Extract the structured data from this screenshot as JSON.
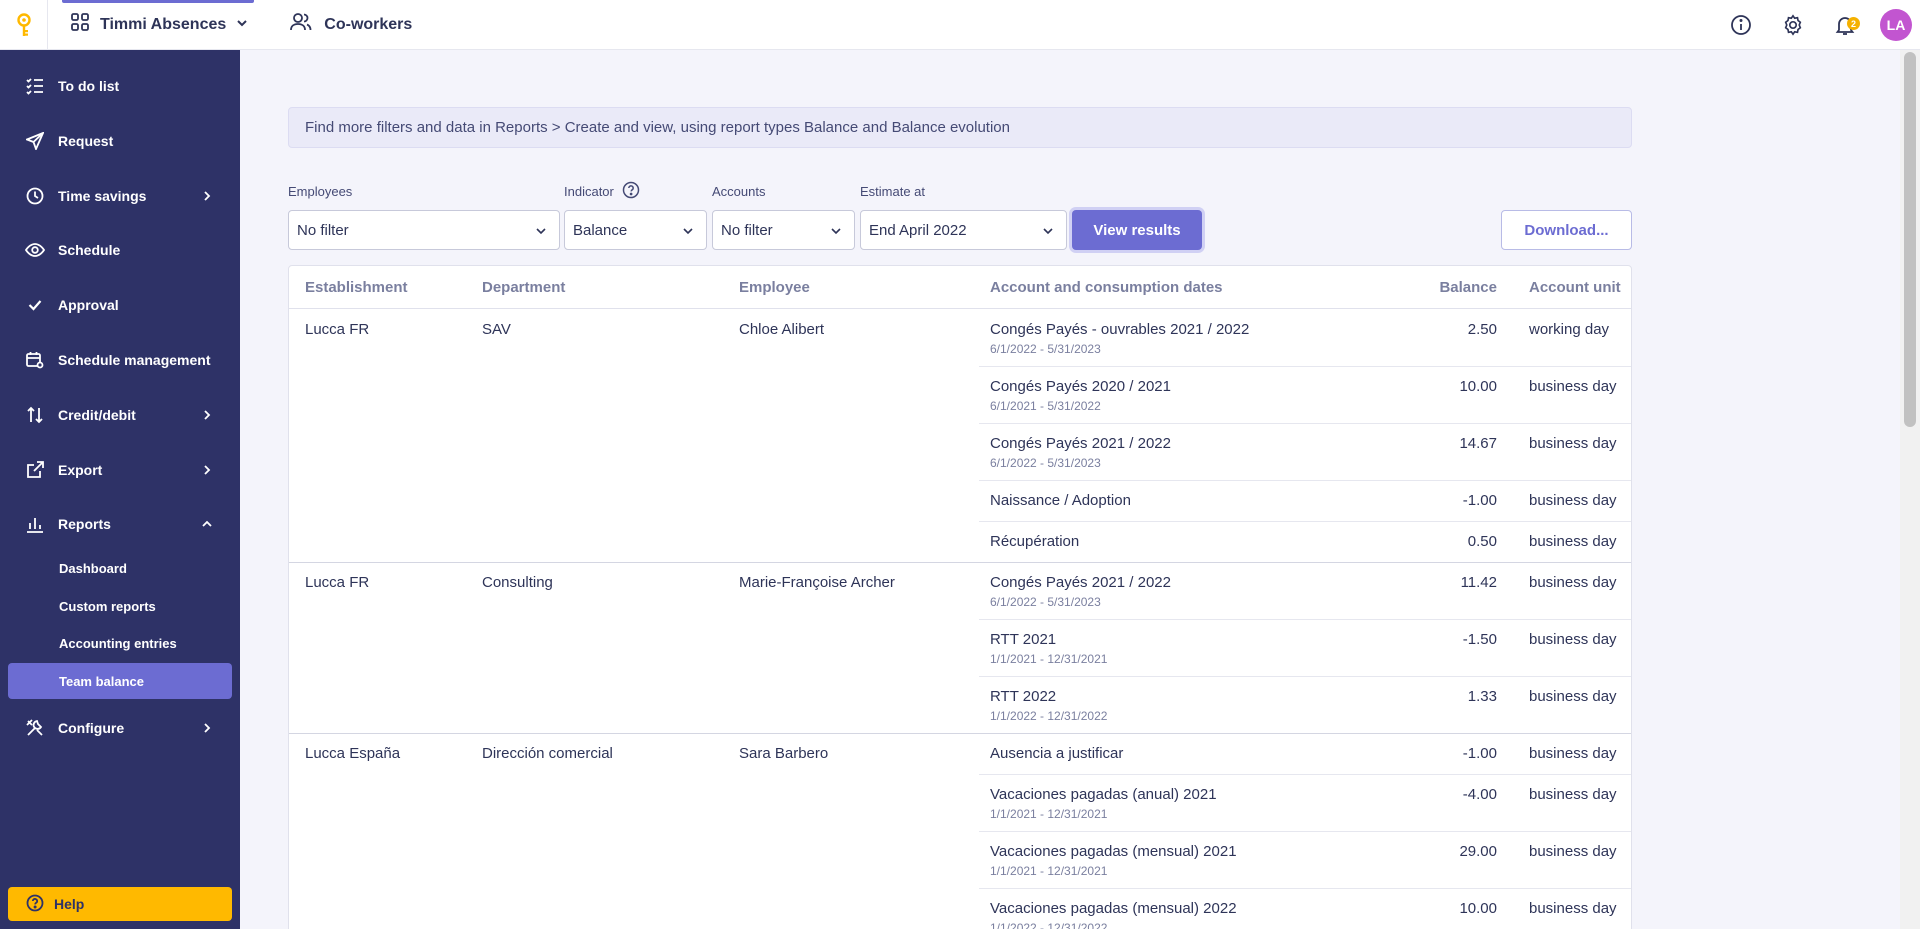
{
  "topbar": {
    "app_name": "Timmi Absences",
    "coworkers": "Co-workers",
    "notif_count": "2",
    "avatar_initials": "LA"
  },
  "sidebar": {
    "items": [
      {
        "label": "To do list"
      },
      {
        "label": "Request"
      },
      {
        "label": "Time savings"
      },
      {
        "label": "Schedule"
      },
      {
        "label": "Approval"
      },
      {
        "label": "Schedule management"
      },
      {
        "label": "Credit/debit"
      },
      {
        "label": "Export"
      },
      {
        "label": "Reports"
      },
      {
        "label": "Configure"
      }
    ],
    "subitems": [
      {
        "label": "Dashboard"
      },
      {
        "label": "Custom reports"
      },
      {
        "label": "Accounting entries"
      },
      {
        "label": "Team balance"
      }
    ],
    "help": "Help"
  },
  "banner": "Find more filters and data in Reports > Create and view, using report types Balance and Balance evolution",
  "filters": {
    "employees_label": "Employees",
    "employees_value": "No filter",
    "indicator_label": "Indicator",
    "indicator_value": "Balance",
    "accounts_label": "Accounts",
    "accounts_value": "No filter",
    "estimate_label": "Estimate at",
    "estimate_value": "End April 2022",
    "view_results": "View results",
    "download": "Download..."
  },
  "table": {
    "headers": [
      "Establishment",
      "Department",
      "Employee",
      "Account and consumption dates",
      "Balance",
      "Account unit"
    ],
    "groups": [
      {
        "establishment": "Lucca FR",
        "department": "SAV",
        "employee": "Chloe Alibert",
        "rows": [
          {
            "account": "Congés Payés - ouvrables 2021 / 2022",
            "dates": "6/1/2022 - 5/31/2023",
            "balance": "2.50",
            "unit": "working day"
          },
          {
            "account": "Congés Payés 2020 / 2021",
            "dates": "6/1/2021 - 5/31/2022",
            "balance": "10.00",
            "unit": "business day"
          },
          {
            "account": "Congés Payés 2021 / 2022",
            "dates": "6/1/2022 - 5/31/2023",
            "balance": "14.67",
            "unit": "business day"
          },
          {
            "account": "Naissance / Adoption",
            "dates": "",
            "balance": "-1.00",
            "unit": "business day"
          },
          {
            "account": "Récupération",
            "dates": "",
            "balance": "0.50",
            "unit": "business day"
          }
        ]
      },
      {
        "establishment": "Lucca FR",
        "department": "Consulting",
        "employee": "Marie-Françoise Archer",
        "rows": [
          {
            "account": "Congés Payés 2021 / 2022",
            "dates": "6/1/2022 - 5/31/2023",
            "balance": "11.42",
            "unit": "business day"
          },
          {
            "account": "RTT 2021",
            "dates": "1/1/2021 - 12/31/2021",
            "balance": "-1.50",
            "unit": "business day"
          },
          {
            "account": "RTT 2022",
            "dates": "1/1/2022 - 12/31/2022",
            "balance": "1.33",
            "unit": "business day"
          }
        ]
      },
      {
        "establishment": "Lucca España",
        "department": "Dirección comercial",
        "employee": "Sara Barbero",
        "rows": [
          {
            "account": "Ausencia a justificar",
            "dates": "",
            "balance": "-1.00",
            "unit": "business day"
          },
          {
            "account": "Vacaciones pagadas (anual) 2021",
            "dates": "1/1/2021 - 12/31/2021",
            "balance": "-4.00",
            "unit": "business day"
          },
          {
            "account": "Vacaciones pagadas (mensual) 2021",
            "dates": "1/1/2021 - 12/31/2021",
            "balance": "29.00",
            "unit": "business day"
          },
          {
            "account": "Vacaciones pagadas (mensual) 2022",
            "dates": "1/1/2022 - 12/31/2022",
            "balance": "10.00",
            "unit": "business day"
          }
        ]
      }
    ]
  }
}
